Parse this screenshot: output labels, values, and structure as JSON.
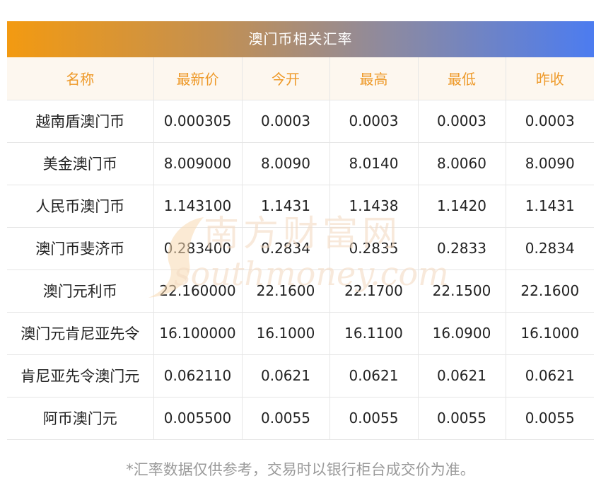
{
  "title": "澳门币相关汇率",
  "columns": [
    "名称",
    "最新价",
    "今开",
    "最高",
    "最低",
    "昨收"
  ],
  "rows": [
    [
      "越南盾澳门币",
      "0.000305",
      "0.0003",
      "0.0003",
      "0.0003",
      "0.0003"
    ],
    [
      "美金澳门币",
      "8.009000",
      "8.0090",
      "8.0140",
      "8.0060",
      "8.0090"
    ],
    [
      "人民币澳门币",
      "1.143100",
      "1.1431",
      "1.1438",
      "1.1420",
      "1.1431"
    ],
    [
      "澳门币斐济币",
      "0.283400",
      "0.2834",
      "0.2835",
      "0.2833",
      "0.2834"
    ],
    [
      "澳门元利币",
      "22.160000",
      "22.1600",
      "22.1700",
      "22.1500",
      "22.1600"
    ],
    [
      "澳门元肯尼亚先令",
      "16.100000",
      "16.1000",
      "16.1100",
      "16.0900",
      "16.1000"
    ],
    [
      "肯尼亚先令澳门元",
      "0.062110",
      "0.0621",
      "0.0621",
      "0.0621",
      "0.0621"
    ],
    [
      "阿币澳门元",
      "0.005500",
      "0.0055",
      "0.0055",
      "0.0055",
      "0.0055"
    ]
  ],
  "watermark": {
    "cn": "南方财富网",
    "en": "southmoney.com"
  },
  "footnote": "*汇率数据仅供参考，交易时以银行柜台成交价为准。",
  "colors": {
    "title_gradient_start": "#f39a11",
    "title_gradient_end": "#4c7cf0",
    "header_text": "#ee9a2a",
    "header_bg": "#fdf7ef",
    "footnote_text": "#9a9a9a"
  }
}
